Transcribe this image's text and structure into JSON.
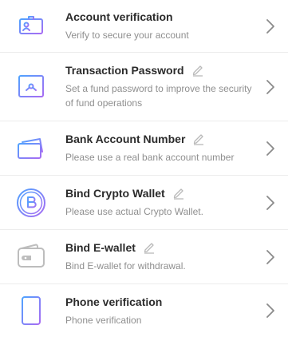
{
  "colors": {
    "accent_blue": "#4fa3ff",
    "accent_purple": "#a86cf3",
    "title": "#2b2b2b",
    "desc": "#8f8f8f",
    "divider": "#ececec",
    "edit_icon": "#b9b9b9",
    "chevron": "#8a8a8a",
    "wallet_gray": "#bdbdbd"
  },
  "items": [
    {
      "title": "Account verification",
      "desc": "Verify to secure your account",
      "icon": "id-card-icon",
      "editable": false
    },
    {
      "title": "Transaction Password",
      "desc": "Set a fund password to improve the security of fund operations",
      "icon": "safe-icon",
      "editable": true
    },
    {
      "title": "Bank Account Number",
      "desc": "Please use a real bank account number",
      "icon": "bank-card-icon",
      "editable": true
    },
    {
      "title": "Bind Crypto Wallet",
      "desc": "Please use actual Crypto Wallet.",
      "icon": "bitcoin-icon",
      "editable": true
    },
    {
      "title": "Bind E-wallet",
      "desc": "Bind E-wallet for withdrawal.",
      "icon": "wallet-icon",
      "editable": true
    },
    {
      "title": "Phone verification",
      "desc": "Phone verification",
      "icon": "phone-icon",
      "editable": false
    }
  ]
}
